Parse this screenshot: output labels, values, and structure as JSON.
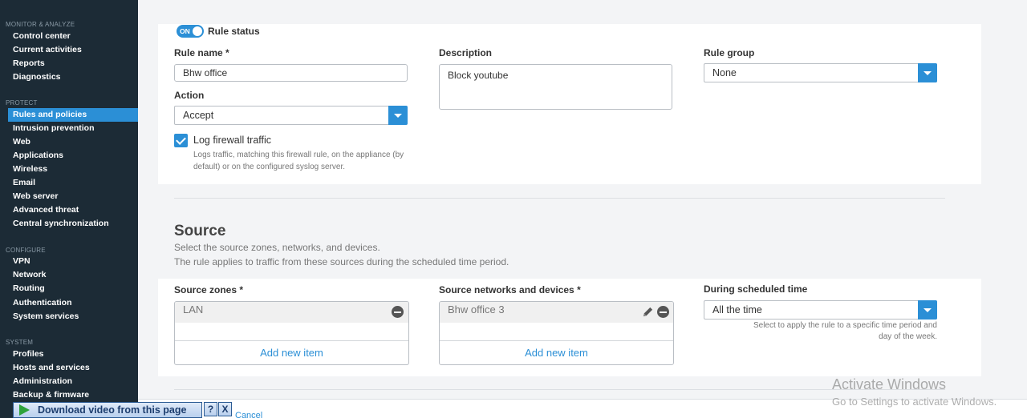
{
  "sidebar": {
    "sections": [
      {
        "title": "MONITOR & ANALYZE",
        "items": [
          "Control center",
          "Current activities",
          "Reports",
          "Diagnostics"
        ]
      },
      {
        "title": "PROTECT",
        "items": [
          "Rules and policies",
          "Intrusion prevention",
          "Web",
          "Applications",
          "Wireless",
          "Email",
          "Web server",
          "Advanced threat",
          "Central synchronization"
        ]
      },
      {
        "title": "CONFIGURE",
        "items": [
          "VPN",
          "Network",
          "Routing",
          "Authentication",
          "System services"
        ]
      },
      {
        "title": "SYSTEM",
        "items": [
          "Profiles",
          "Hosts and services",
          "Administration",
          "Backup & firmware"
        ]
      }
    ],
    "active": "Rules and policies"
  },
  "rule": {
    "status_toggle": "ON",
    "status_label": "Rule status",
    "name_label": "Rule name *",
    "name_value": "Bhw office",
    "description_label": "Description",
    "description_value": "Block youtube",
    "group_label": "Rule group",
    "group_value": "None",
    "action_label": "Action",
    "action_value": "Accept",
    "log_label": "Log firewall traffic",
    "log_hint_1": "Logs traffic, matching this firewall rule, on the appliance (by",
    "log_hint_2": "default) or on the configured syslog server."
  },
  "source": {
    "title": "Source",
    "desc_1": "Select the source zones, networks, and devices.",
    "desc_2": "The rule applies to traffic from these sources during the scheduled time period.",
    "zones_label": "Source zones *",
    "zones_item": "LAN",
    "networks_label": "Source networks and devices *",
    "networks_item": "Bhw office 3",
    "add_new": "Add new item",
    "schedule_label": "During scheduled time",
    "schedule_value": "All the time",
    "schedule_hint_1": "Select to apply the rule to a specific time period and",
    "schedule_hint_2": "day of the week."
  },
  "watermark": {
    "line1": "Activate Windows",
    "line2": "Go to Settings to activate Windows."
  },
  "download_bar": {
    "label": "Download video from this page",
    "help": "?",
    "close": "X"
  },
  "footer": {
    "cancel": "Cancel"
  },
  "colors": {
    "accent": "#2b8fd6",
    "sidebar_bg": "#1c2b36"
  }
}
